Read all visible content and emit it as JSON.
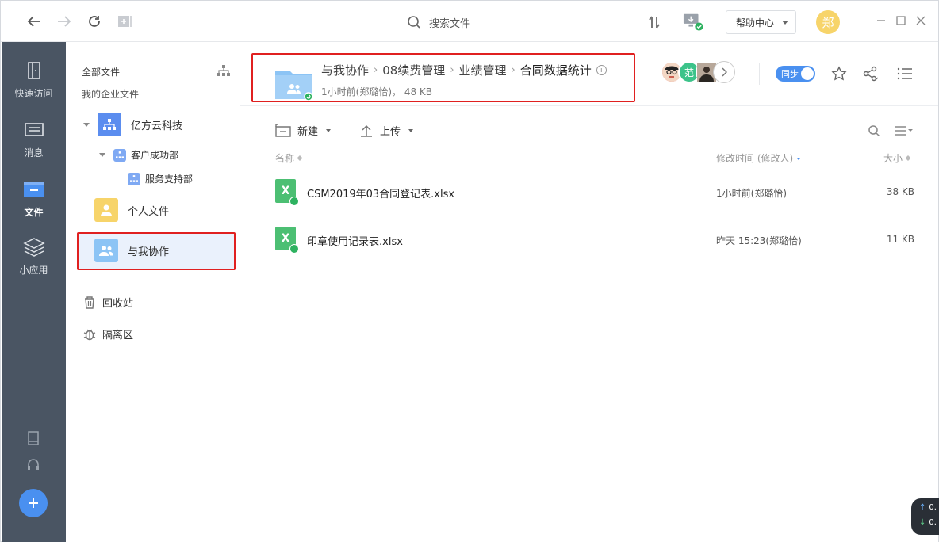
{
  "topbar": {
    "search_placeholder": "搜索文件",
    "help_label": "帮助中心",
    "user_avatar_text": "郑"
  },
  "rail": {
    "items": [
      {
        "label": "快速访问",
        "icon": "quick-access-icon"
      },
      {
        "label": "消息",
        "icon": "message-icon"
      },
      {
        "label": "文件",
        "icon": "file-icon",
        "active": true
      },
      {
        "label": "小应用",
        "icon": "apps-icon"
      }
    ]
  },
  "sidebar": {
    "all_files": "全部文件",
    "enterprise_files": "我的企业文件",
    "tree": [
      {
        "label": "亿方云科技",
        "level": 0
      },
      {
        "label": "客户成功部",
        "level": 1
      },
      {
        "label": "服务支持部",
        "level": 2
      }
    ],
    "personal_files": "个人文件",
    "shared_with_me": "与我协作",
    "recycle_bin": "回收站",
    "quarantine": "隔离区"
  },
  "folder": {
    "breadcrumb": [
      "与我协作",
      "08续费管理",
      "业绩管理",
      "合同数据统计"
    ],
    "meta": "1小时前(郑璐怡)， 48 KB",
    "members": [
      {
        "text": "",
        "color": "#e05a5a"
      },
      {
        "text": "范",
        "color": "#3cc38a"
      },
      {
        "text": "",
        "color": "#8a6f5c"
      }
    ],
    "sync_label": "同步"
  },
  "toolbar": {
    "new_label": "新建",
    "upload_label": "上传"
  },
  "columns": {
    "name": "名称",
    "modified": "修改时间 (修改人)",
    "size": "大小"
  },
  "files": [
    {
      "icon_letter": "X",
      "name": "CSM2019年03合同登记表.xlsx",
      "modified": "1小时前(郑璐怡)",
      "size": "38 KB"
    },
    {
      "icon_letter": "X",
      "name": "印章使用记录表.xlsx",
      "modified": "昨天 15:23(郑璐怡)",
      "size": "11 KB"
    }
  ],
  "speed": {
    "up": "0.",
    "down": "0."
  },
  "colors": {
    "accent": "#4a90f0",
    "rail_bg": "#4a5563",
    "highlight_border": "#e02020",
    "excel_green": "#4cbf73"
  }
}
